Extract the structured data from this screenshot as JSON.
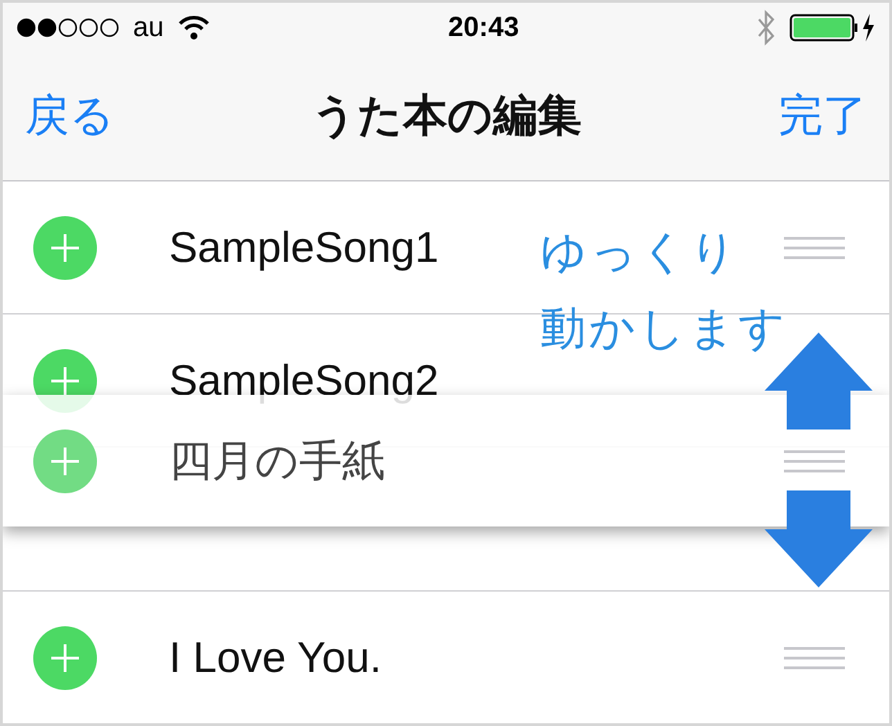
{
  "status_bar": {
    "carrier": "au",
    "time": "20:43"
  },
  "nav_bar": {
    "back": "戻る",
    "title": "うた本の編集",
    "done": "完了"
  },
  "rows": [
    {
      "kind": "song",
      "title": "SampleSong1"
    },
    {
      "kind": "song",
      "title": "SampleSong2"
    },
    {
      "kind": "gap"
    },
    {
      "kind": "song",
      "title": "I Love You."
    }
  ],
  "dragged_row": {
    "title": "四月の手紙"
  },
  "annotation": {
    "lines": [
      "ゆっくり",
      "動かします"
    ]
  }
}
